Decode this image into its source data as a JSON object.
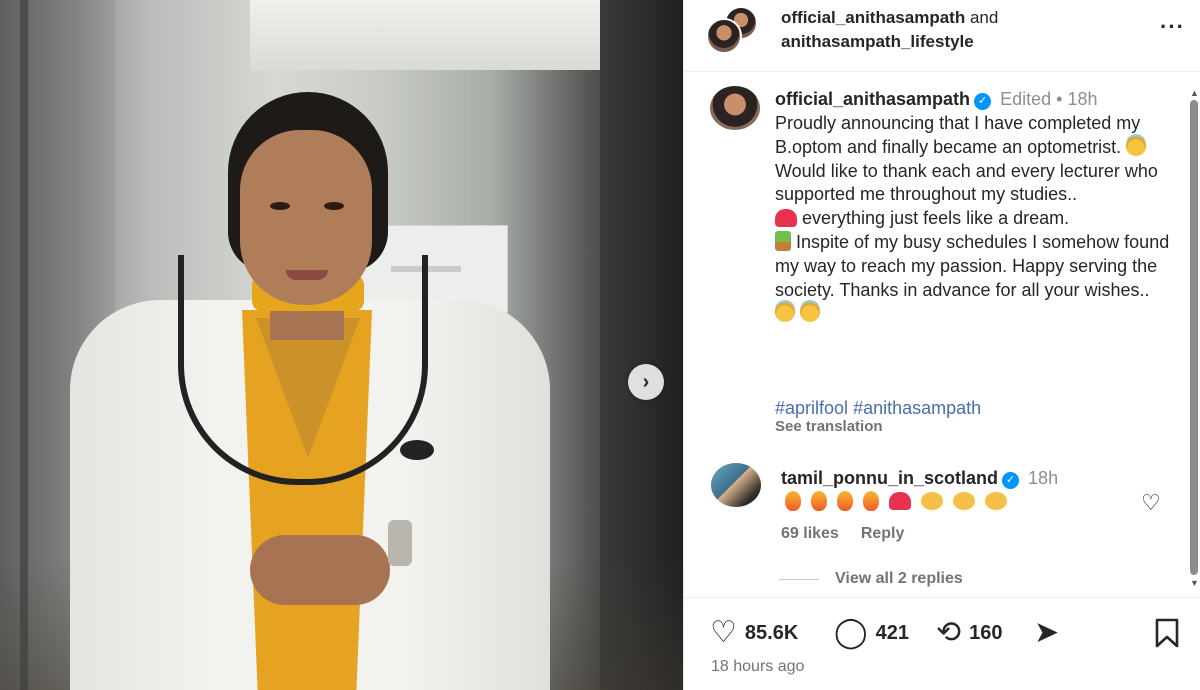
{
  "header": {
    "user1": "official_anithasampath",
    "conjunction": "and",
    "user2": "anithasampath_lifestyle",
    "more_icon": "···"
  },
  "caption": {
    "username": "official_anithasampath",
    "verified_icon": "✓",
    "edited": "Edited",
    "separator": "•",
    "time": "18h",
    "line1": "Proudly announcing that I have completed my B.optom and finally became an optometrist.",
    "line2": "Would like to thank each and every lecturer who supported me throughout my studies..",
    "line3": "everything just feels like a dream.",
    "line4": "Inspite of my busy schedules I somehow found my way to reach my passion. Happy serving the society. Thanks in advance for all your wishes..",
    "hashtag1": "#aprilfool",
    "hashtag2": "#anithasampath",
    "see_translation": "See translation"
  },
  "comment": {
    "username": "tamil_ponnu_in_scotland",
    "time": "18h",
    "emoji_sequence": [
      "fire-emoji",
      "fire-emoji",
      "fire-emoji",
      "fire-emoji",
      "heart-emoji",
      "clap-emoji",
      "clap-emoji",
      "clap-emoji"
    ],
    "likes": "69 likes",
    "reply": "Reply",
    "view_replies": "View all 2 replies"
  },
  "actions": {
    "like_count": "85.6K",
    "comment_count": "421",
    "repost_count": "160",
    "timestamp": "18 hours ago"
  },
  "icons": {
    "next": "›",
    "heart": "♡",
    "comment": "◯",
    "repost": "⟲",
    "send": "➤",
    "save": "🔖"
  },
  "colors": {
    "verified": "#0095f6",
    "hashtag": "#4a6ea9",
    "muted": "#737373"
  }
}
